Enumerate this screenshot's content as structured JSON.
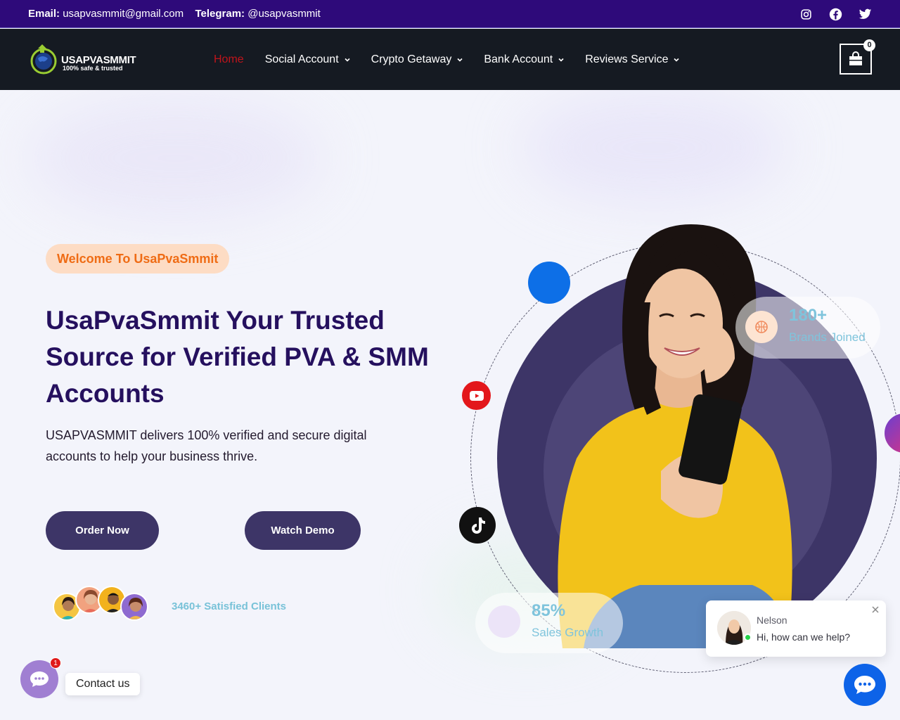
{
  "topbar": {
    "email_label": "Email:",
    "email_value": "usapvasmmit@gmail.com",
    "telegram_label": "Telegram:",
    "telegram_value": "@usapvasmmit",
    "social_icons": [
      "instagram-icon",
      "facebook-icon",
      "twitter-icon"
    ]
  },
  "brand": {
    "name": "USAPVASMMIT",
    "tagline": "100% safe & trusted"
  },
  "nav": {
    "items": [
      {
        "label": "Home",
        "active": true,
        "dropdown": false
      },
      {
        "label": "Social Account",
        "active": false,
        "dropdown": true
      },
      {
        "label": "Crypto Getaway",
        "active": false,
        "dropdown": true
      },
      {
        "label": "Bank Account",
        "active": false,
        "dropdown": true
      },
      {
        "label": "Reviews Service",
        "active": false,
        "dropdown": true
      }
    ],
    "cart_count": "0"
  },
  "hero": {
    "badge": "Welcome To UsaPvaSmmit",
    "title": "UsaPvaSmmit Your Trusted Source for Verified PVA & SMM Accounts",
    "description": "USAPVASMMIT delivers 100% verified and secure digital accounts to help your business thrive.",
    "order_button": "Order Now",
    "demo_button": "Watch Demo",
    "clients_text": "3460+ Satisfied Clients"
  },
  "stats": {
    "brands_value": "180+",
    "brands_label": "Brands Joined",
    "sales_value": "85%",
    "sales_label": "Sales Growth"
  },
  "chat": {
    "agent_name": "Nelson",
    "message": "Hi, how can we help?",
    "contact_label": "Contact us",
    "contact_badge": "1"
  },
  "colors": {
    "topbar_bg": "#2e0a7a",
    "navbar_bg": "#151a22",
    "accent_red": "#c0141b",
    "primary_button": "#3d3567",
    "title_color": "#25105e",
    "badge_orange": "#ef6c15",
    "stat_cyan": "#7fc4dc",
    "chat_blue": "#0d63e8"
  }
}
